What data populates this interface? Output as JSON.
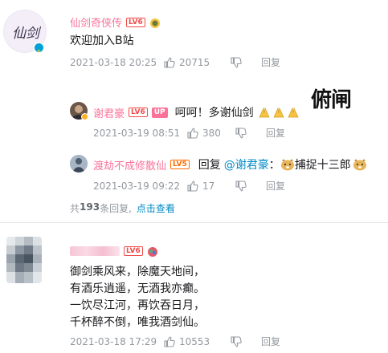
{
  "comment1": {
    "user": "仙剑奇侠传",
    "level": "LV6",
    "avatar_text": "仙剑",
    "text": "欢迎加入B站",
    "time": "2021-03-18 20:25",
    "likes": "20715",
    "reply_label": "回复",
    "replies": [
      {
        "user": "谢君豪",
        "level": "LV6",
        "up_tag": "UP",
        "text": "呵呵！多谢仙剑",
        "sticker_text": "俯闸",
        "time": "2021-03-19 08:51",
        "likes": "380",
        "reply_label": "回复"
      },
      {
        "user": "渡劫不成修散仙",
        "level": "LV5",
        "reply_prefix": "回复",
        "mention": "@谢君豪",
        "colon": "：",
        "text": "捕捉十三郎",
        "time": "2021-03-19 09:22",
        "likes": "17",
        "reply_label": "回复"
      }
    ],
    "more_count_prefix": "共",
    "more_count": "193",
    "more_count_suffix": "条回复,",
    "view_link": "点击查看"
  },
  "comment2": {
    "level": "LV6",
    "lines": [
      "御剑乘风来，除魔天地间，",
      "有酒乐逍遥，无酒我亦癫。",
      "一饮尽江河，再饮吞日月，",
      "千杯醉不倒，唯我酒剑仙。"
    ],
    "time": "2021-03-18 17:29",
    "likes": "10553",
    "reply_label": "回复"
  },
  "colors": {
    "vip_name": "#fb7299",
    "link": "#008ac5",
    "meta": "#9499a0"
  }
}
